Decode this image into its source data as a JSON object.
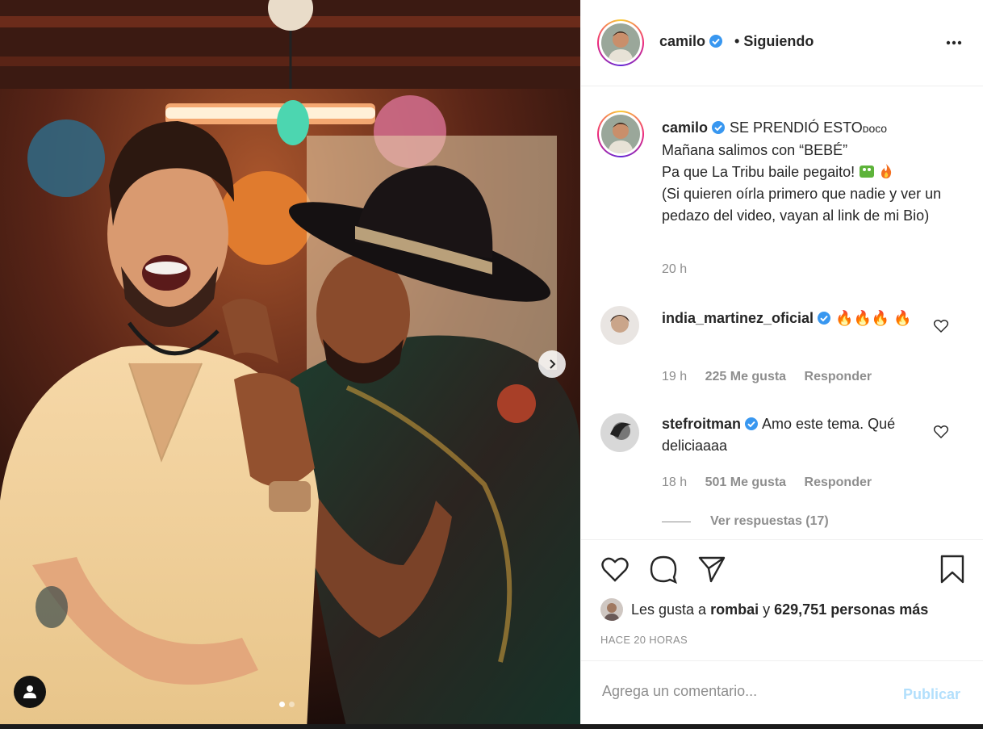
{
  "header": {
    "username": "camilo",
    "separator": "•",
    "follow_status": "Siguiendo",
    "more_icon": "more-horizontal-icon"
  },
  "caption": {
    "username": "camilo",
    "lines": [
      "SE PRENDIÓ ESTO",
      "Mañana salimos con “BEBÉ”",
      "Pa que La Tribu baile pegaito!",
      "(Si quieren oírla primero que nadie y ver un pedazo del video, vayan al link de mi Bio)"
    ],
    "emoji_suffix_1": "ᴅᴏᴄᴏ",
    "time": "20 h"
  },
  "comments": [
    {
      "username": "india_martinez_oficial",
      "text": "🔥🔥🔥 🔥",
      "time": "19 h",
      "likes": "225 Me gusta",
      "reply": "Responder"
    },
    {
      "username": "stefroitman",
      "text": "Amo este tema. Qué deliciaaaa",
      "time": "18 h",
      "likes": "501 Me gusta",
      "reply": "Responder"
    }
  ],
  "view_replies": "Ver respuestas (17)",
  "likes": {
    "prefix": "Les gusta a",
    "user": "rombai",
    "connector": "y",
    "count": "629,751 personas más"
  },
  "timestamp": "HACE 20 HORAS",
  "comment_box": {
    "placeholder": "Agrega un comentario...",
    "publish": "Publicar"
  },
  "carousel": {
    "current": 1,
    "total": 2
  },
  "colors": {
    "verified": "#3897f0",
    "publish_disabled": "#b2dffc",
    "secondary_text": "#8e8e8e"
  }
}
